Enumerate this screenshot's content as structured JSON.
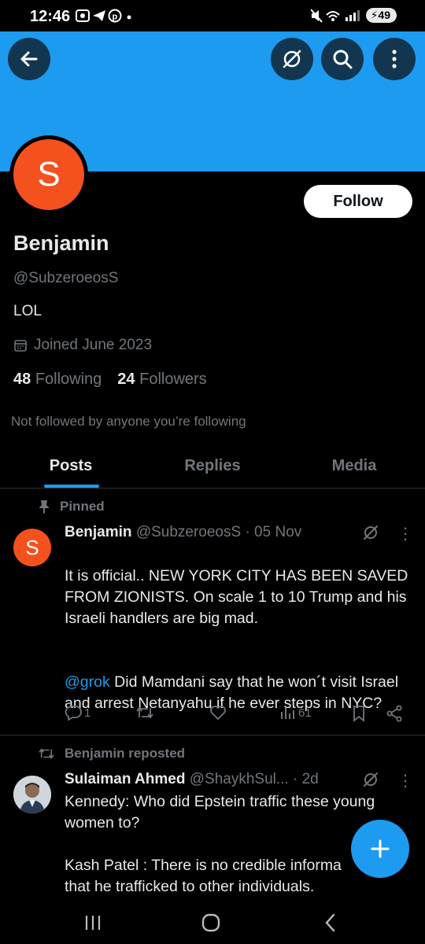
{
  "status_bar": {
    "time": "12:46",
    "notification_icons": [
      "screenshot-icon",
      "telegram-icon",
      "pinterest-icon",
      "dot-icon"
    ],
    "battery": "49"
  },
  "header": {
    "back_icon": "back-arrow-icon",
    "grok_icon": "grok-icon",
    "search_icon": "search-icon",
    "more_icon": "more-vertical-icon",
    "banner_color": "#1d9bf0"
  },
  "profile": {
    "avatar_letter": "S",
    "avatar_color": "#f4511e",
    "follow_label": "Follow",
    "display_name": "Benjamin",
    "handle": "@SubzeroeosS",
    "bio": "LOL",
    "joined": "Joined June 2023",
    "following_count": "48",
    "following_label": "Following",
    "followers_count": "24",
    "followers_label": "Followers",
    "not_followed_text": "Not followed by anyone you’re following"
  },
  "tabs": [
    {
      "label": "Posts",
      "active": true
    },
    {
      "label": "Replies",
      "active": false
    },
    {
      "label": "Media",
      "active": false
    }
  ],
  "posts": [
    {
      "context": "Pinned",
      "avatar_letter": "S",
      "name": "Benjamin",
      "meta": "@SubzeroeosS · 05 Nov",
      "text_1": "It is official.. NEW YORK CITY HAS BEEN SAVED FROM ZIONISTS. On scale 1 to 10 Trump and his Israeli handlers are big mad.",
      "mention": "@grok",
      "text_2": "Did Mamdani say that he won´t visit Israel and arrest Netanyahu if he ever steps in NYC?",
      "replies": "1",
      "reposts": "",
      "likes": "",
      "views": "61"
    },
    {
      "context": "Benjamin reposted",
      "name": "Sulaiman Ahmed",
      "meta": "@ShaykhSul... · 2d",
      "text": "Kennedy: Who did Epstein traffic these young women to?\n\nKash Patel : There is no credible informa\nthat he trafficked to other individuals."
    }
  ],
  "accent_color": "#1d9bf0",
  "fab_icon": "plus-icon"
}
